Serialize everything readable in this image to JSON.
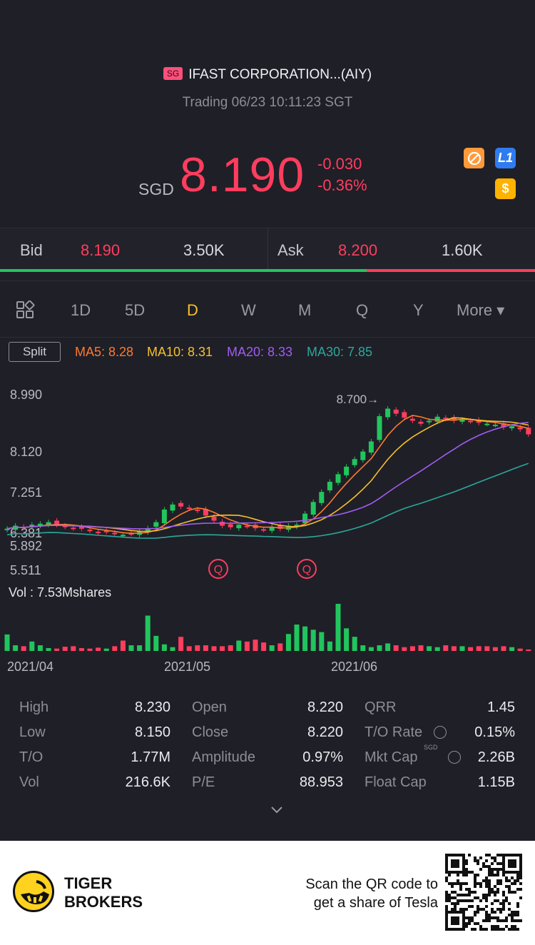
{
  "header": {
    "market_badge": "SG",
    "name": "IFAST CORPORATION...(AIY)",
    "status": "Trading 06/23 10:11:23 SGT",
    "currency": "SGD",
    "price": "8.190",
    "change": "-0.030",
    "change_pct": "-0.36%",
    "icons": [
      "no-short-icon",
      "level1-icon",
      "dollar-icon"
    ],
    "level_label": "L1",
    "dollar_label": "$"
  },
  "bidask": {
    "bid_label": "Bid",
    "bid_price": "8.190",
    "bid_size": "3.50K",
    "ask_label": "Ask",
    "ask_price": "8.200",
    "ask_size": "1.60K",
    "bid_share": 0.685
  },
  "tabs": [
    "1D",
    "5D",
    "D",
    "W",
    "M",
    "Q",
    "Y",
    "More ▾"
  ],
  "active_tab": "D",
  "indicators": {
    "split_label": "Split",
    "ma5": "MA5: 8.28",
    "ma10": "MA10: 8.31",
    "ma20": "MA20: 8.33",
    "ma30": "MA30: 7.85"
  },
  "chart_data": {
    "type": "candlestick",
    "y_ticks": [
      "8.990",
      "8.120",
      "7.251",
      "6.381",
      "5.892",
      "5.511"
    ],
    "high_marker": "8.700",
    "vol_label": "Vol  : 7.53Mshares",
    "x_labels": [
      "2021/04",
      "2021/05",
      "2021/06"
    ],
    "event_marker": "Q",
    "colors": {
      "up": "#21c55d",
      "down": "#ff3d5e",
      "ma5": "#ff7a2e",
      "ma10": "#f5c12b",
      "ma20": "#a15cf3",
      "ma30": "#2aa89b"
    },
    "close": [
      6.32,
      6.38,
      6.34,
      6.4,
      6.42,
      6.45,
      6.4,
      6.36,
      6.33,
      6.32,
      6.28,
      6.25,
      6.26,
      6.22,
      6.2,
      6.22,
      6.27,
      6.33,
      6.45,
      6.7,
      6.8,
      6.76,
      6.72,
      6.68,
      6.58,
      6.48,
      6.38,
      6.35,
      6.4,
      6.37,
      6.33,
      6.3,
      6.36,
      6.32,
      6.38,
      6.4,
      6.62,
      6.85,
      7.05,
      7.25,
      7.4,
      7.55,
      7.7,
      7.85,
      8.05,
      8.55,
      8.7,
      8.6,
      8.52,
      8.46,
      8.4,
      8.46,
      8.54,
      8.5,
      8.46,
      8.48,
      8.45,
      8.42,
      8.4,
      8.38,
      8.33,
      8.35,
      8.29,
      8.19
    ],
    "volume_rel": [
      0.35,
      0.12,
      0.1,
      0.2,
      0.12,
      0.06,
      0.05,
      0.09,
      0.1,
      0.06,
      0.05,
      0.07,
      0.05,
      0.1,
      0.22,
      0.12,
      0.12,
      0.75,
      0.32,
      0.14,
      0.08,
      0.3,
      0.1,
      0.12,
      0.12,
      0.1,
      0.1,
      0.12,
      0.22,
      0.2,
      0.24,
      0.18,
      0.12,
      0.16,
      0.36,
      0.56,
      0.52,
      0.45,
      0.4,
      0.2,
      1.0,
      0.48,
      0.3,
      0.12,
      0.08,
      0.12,
      0.16,
      0.12,
      0.08,
      0.1,
      0.12,
      0.1,
      0.08,
      0.12,
      0.1,
      0.1,
      0.08,
      0.1,
      0.1,
      0.08,
      0.1,
      0.08,
      0.05,
      0.03
    ]
  },
  "stats": {
    "rows": [
      [
        [
          "High",
          "8.230"
        ],
        [
          "Open",
          "8.220"
        ],
        [
          "QRR",
          "1.45"
        ]
      ],
      [
        [
          "Low",
          "8.150"
        ],
        [
          "Close",
          "8.220"
        ],
        [
          "T/O Rate",
          "0.15%"
        ]
      ],
      [
        [
          "T/O",
          "1.77M"
        ],
        [
          "Amplitude",
          "0.97%"
        ],
        [
          "Mkt Cap",
          "2.26B"
        ]
      ],
      [
        [
          "Vol",
          "216.6K"
        ],
        [
          "P/E",
          "88.953"
        ],
        [
          "Float Cap",
          "1.15B"
        ]
      ]
    ],
    "mktcap_unit": "SGD"
  },
  "footer": {
    "brand_line1": "TIGER",
    "brand_line2": "BROKERS",
    "scan_line1": "Scan the QR code to",
    "scan_line2": "get a share of Tesla"
  }
}
